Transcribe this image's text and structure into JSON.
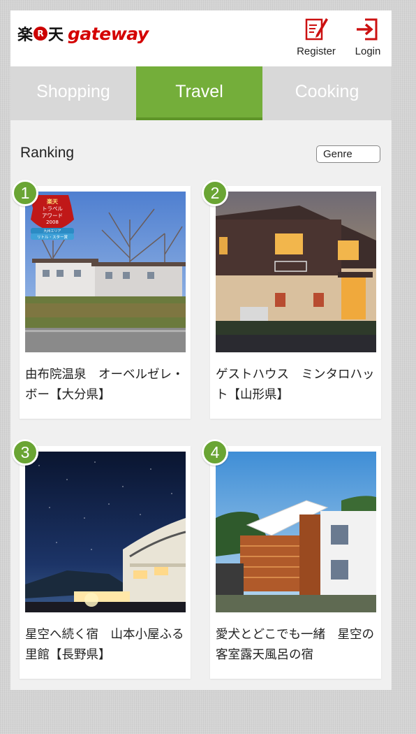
{
  "header": {
    "logo_kanji_1": "楽",
    "logo_r": "R",
    "logo_kanji_2": "天",
    "logo_text": "gateway",
    "register_label": "Register",
    "login_label": "Login"
  },
  "tabs": [
    {
      "label": "Shopping",
      "active": false
    },
    {
      "label": "Travel",
      "active": true
    },
    {
      "label": "Cooking",
      "active": false
    }
  ],
  "section": {
    "title": "Ranking",
    "genre_label": "Genre"
  },
  "ranking": [
    {
      "rank": "1",
      "title": "由布院温泉　オーベルゼレ・ボー【大分県】",
      "award": {
        "line1": "楽天",
        "line2": "トラベル",
        "line3": "アワード",
        "line4": "2008",
        "line5": "九州エリア",
        "line6": "リトル・スター賞"
      }
    },
    {
      "rank": "2",
      "title": "ゲストハウス　ミンタロハット【山形県】"
    },
    {
      "rank": "3",
      "title": "星空へ続く宿　山本小屋ふる里館【長野県】"
    },
    {
      "rank": "4",
      "title": "愛犬とどこでも一緒　星空の客室露天風呂の宿"
    }
  ],
  "colors": {
    "accent_green": "#74ae3a",
    "badge_green": "#6aa534",
    "brand_red": "#d40000"
  }
}
